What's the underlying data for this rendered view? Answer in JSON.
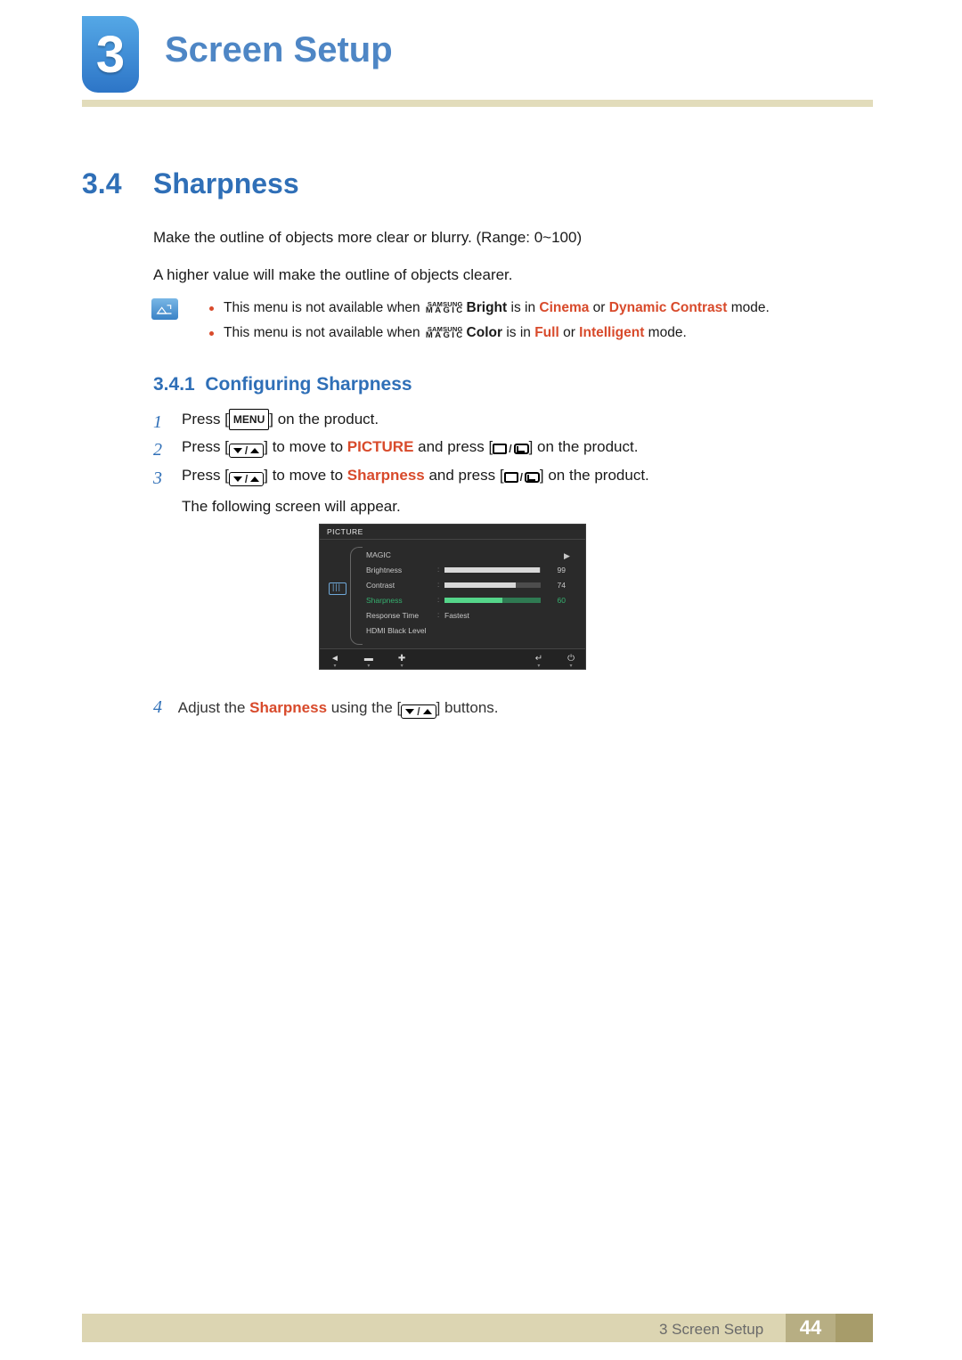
{
  "header": {
    "chapter_number": "3",
    "chapter_title": "Screen Setup"
  },
  "section": {
    "num": "3.4",
    "title": "Sharpness",
    "p_clear": "Make the outline of objects more clear or blurry. (Range: 0~100)",
    "p_higher": "A higher value will make the outline of objects clearer."
  },
  "notes": {
    "line1_pre": "This menu is not available when ",
    "magic_small": "SAMSUNG",
    "magic_big": "MAGIC",
    "line1_feature": "Bright",
    "line1_mid": " is in ",
    "line1_hl1": "Cinema",
    "line1_or": " or ",
    "line1_hl2": "Dynamic Contrast",
    "line1_post": " mode.",
    "line2_pre": "This menu is not available when ",
    "line2_feature": "Color",
    "line2_mid": " is in ",
    "line2_hl1": "Full",
    "line2_or": " or ",
    "line2_hl2": "Intelligent",
    "line2_post": " mode."
  },
  "subsection": {
    "num": "3.4.1",
    "title": "Configuring Sharpness"
  },
  "steps": {
    "s1_num": "1",
    "s1_a": "Press [",
    "s1_menu": "MENU",
    "s1_b": "] on the product.",
    "s2_num": "2",
    "s2_a": "Press [",
    "s2_b": "] to move to ",
    "s2_pic": "PICTURE",
    "s2_c": " and press [",
    "s2_d": "] on the product.",
    "s3_num": "3",
    "s3_a": "Press [",
    "s3_b": "] to move to ",
    "s3_sharp": "Sharpness",
    "s3_c": " and press [",
    "s3_d": "] on the product.",
    "s3_extra": "The following screen will appear.",
    "s4_num": "4",
    "s4_a": "Adjust the ",
    "s4_sharp": "Sharpness",
    "s4_b": " using the [",
    "s4_c": "] buttons."
  },
  "osd": {
    "header": "PICTURE",
    "rows": {
      "magic": "MAGIC",
      "brightness": "Brightness",
      "brightness_val": "99",
      "contrast": "Contrast",
      "contrast_val": "74",
      "sharpness": "Sharpness",
      "sharpness_val": "60",
      "response": "Response Time",
      "response_val": "Fastest",
      "hdmi": "HDMI Black Level"
    }
  },
  "chart_data": {
    "type": "bar",
    "title": "PICTURE menu slider values",
    "categories": [
      "Brightness",
      "Contrast",
      "Sharpness"
    ],
    "values": [
      99,
      74,
      60
    ],
    "ylim": [
      0,
      100
    ],
    "xlabel": "",
    "ylabel": ""
  },
  "footer": {
    "chapter_ref": "3 Screen Setup",
    "page": "44"
  }
}
